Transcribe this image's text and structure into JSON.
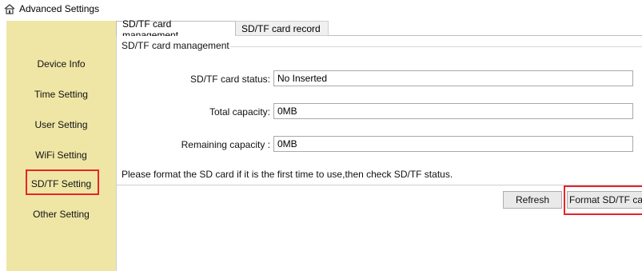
{
  "window": {
    "title": "Advanced Settings",
    "icon": "house-icon"
  },
  "sidebar": {
    "items": [
      {
        "label": "Device Info"
      },
      {
        "label": "Time Setting"
      },
      {
        "label": "User Setting"
      },
      {
        "label": "WiFi Setting"
      },
      {
        "label": "SD/TF Setting"
      },
      {
        "label": "Other Setting"
      }
    ],
    "active_index": 4,
    "background": "#efe6a6",
    "highlight_color": "#e8232a"
  },
  "tabs": [
    {
      "label": "SD/TF card management"
    },
    {
      "label": "SD/TF card record"
    }
  ],
  "group": {
    "title": "SD/TF card management",
    "fields": [
      {
        "label": "SD/TF card status:",
        "value": "No Inserted"
      },
      {
        "label": "Total capacity:",
        "value": "0MB"
      },
      {
        "label": "Remaining capacity :",
        "value": "0MB"
      }
    ],
    "notice": "Please format the SD card if it is the first time to use,then check SD/TF status."
  },
  "buttons": {
    "refresh": "Refresh",
    "format": "Format SD/TF card"
  }
}
